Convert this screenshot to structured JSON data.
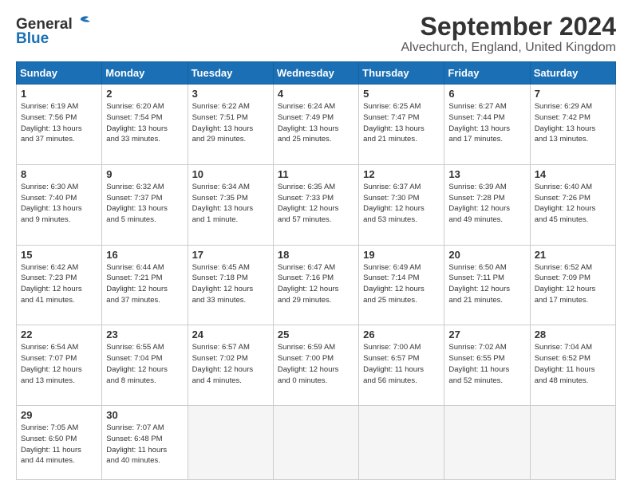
{
  "header": {
    "logo_line1": "General",
    "logo_line2": "Blue",
    "month": "September 2024",
    "location": "Alvechurch, England, United Kingdom"
  },
  "days_of_week": [
    "Sunday",
    "Monday",
    "Tuesday",
    "Wednesday",
    "Thursday",
    "Friday",
    "Saturday"
  ],
  "weeks": [
    [
      {
        "day": "1",
        "info": "Sunrise: 6:19 AM\nSunset: 7:56 PM\nDaylight: 13 hours\nand 37 minutes."
      },
      {
        "day": "2",
        "info": "Sunrise: 6:20 AM\nSunset: 7:54 PM\nDaylight: 13 hours\nand 33 minutes."
      },
      {
        "day": "3",
        "info": "Sunrise: 6:22 AM\nSunset: 7:51 PM\nDaylight: 13 hours\nand 29 minutes."
      },
      {
        "day": "4",
        "info": "Sunrise: 6:24 AM\nSunset: 7:49 PM\nDaylight: 13 hours\nand 25 minutes."
      },
      {
        "day": "5",
        "info": "Sunrise: 6:25 AM\nSunset: 7:47 PM\nDaylight: 13 hours\nand 21 minutes."
      },
      {
        "day": "6",
        "info": "Sunrise: 6:27 AM\nSunset: 7:44 PM\nDaylight: 13 hours\nand 17 minutes."
      },
      {
        "day": "7",
        "info": "Sunrise: 6:29 AM\nSunset: 7:42 PM\nDaylight: 13 hours\nand 13 minutes."
      }
    ],
    [
      {
        "day": "8",
        "info": "Sunrise: 6:30 AM\nSunset: 7:40 PM\nDaylight: 13 hours\nand 9 minutes."
      },
      {
        "day": "9",
        "info": "Sunrise: 6:32 AM\nSunset: 7:37 PM\nDaylight: 13 hours\nand 5 minutes."
      },
      {
        "day": "10",
        "info": "Sunrise: 6:34 AM\nSunset: 7:35 PM\nDaylight: 13 hours\nand 1 minute."
      },
      {
        "day": "11",
        "info": "Sunrise: 6:35 AM\nSunset: 7:33 PM\nDaylight: 12 hours\nand 57 minutes."
      },
      {
        "day": "12",
        "info": "Sunrise: 6:37 AM\nSunset: 7:30 PM\nDaylight: 12 hours\nand 53 minutes."
      },
      {
        "day": "13",
        "info": "Sunrise: 6:39 AM\nSunset: 7:28 PM\nDaylight: 12 hours\nand 49 minutes."
      },
      {
        "day": "14",
        "info": "Sunrise: 6:40 AM\nSunset: 7:26 PM\nDaylight: 12 hours\nand 45 minutes."
      }
    ],
    [
      {
        "day": "15",
        "info": "Sunrise: 6:42 AM\nSunset: 7:23 PM\nDaylight: 12 hours\nand 41 minutes."
      },
      {
        "day": "16",
        "info": "Sunrise: 6:44 AM\nSunset: 7:21 PM\nDaylight: 12 hours\nand 37 minutes."
      },
      {
        "day": "17",
        "info": "Sunrise: 6:45 AM\nSunset: 7:18 PM\nDaylight: 12 hours\nand 33 minutes."
      },
      {
        "day": "18",
        "info": "Sunrise: 6:47 AM\nSunset: 7:16 PM\nDaylight: 12 hours\nand 29 minutes."
      },
      {
        "day": "19",
        "info": "Sunrise: 6:49 AM\nSunset: 7:14 PM\nDaylight: 12 hours\nand 25 minutes."
      },
      {
        "day": "20",
        "info": "Sunrise: 6:50 AM\nSunset: 7:11 PM\nDaylight: 12 hours\nand 21 minutes."
      },
      {
        "day": "21",
        "info": "Sunrise: 6:52 AM\nSunset: 7:09 PM\nDaylight: 12 hours\nand 17 minutes."
      }
    ],
    [
      {
        "day": "22",
        "info": "Sunrise: 6:54 AM\nSunset: 7:07 PM\nDaylight: 12 hours\nand 13 minutes."
      },
      {
        "day": "23",
        "info": "Sunrise: 6:55 AM\nSunset: 7:04 PM\nDaylight: 12 hours\nand 8 minutes."
      },
      {
        "day": "24",
        "info": "Sunrise: 6:57 AM\nSunset: 7:02 PM\nDaylight: 12 hours\nand 4 minutes."
      },
      {
        "day": "25",
        "info": "Sunrise: 6:59 AM\nSunset: 7:00 PM\nDaylight: 12 hours\nand 0 minutes."
      },
      {
        "day": "26",
        "info": "Sunrise: 7:00 AM\nSunset: 6:57 PM\nDaylight: 11 hours\nand 56 minutes."
      },
      {
        "day": "27",
        "info": "Sunrise: 7:02 AM\nSunset: 6:55 PM\nDaylight: 11 hours\nand 52 minutes."
      },
      {
        "day": "28",
        "info": "Sunrise: 7:04 AM\nSunset: 6:52 PM\nDaylight: 11 hours\nand 48 minutes."
      }
    ],
    [
      {
        "day": "29",
        "info": "Sunrise: 7:05 AM\nSunset: 6:50 PM\nDaylight: 11 hours\nand 44 minutes."
      },
      {
        "day": "30",
        "info": "Sunrise: 7:07 AM\nSunset: 6:48 PM\nDaylight: 11 hours\nand 40 minutes."
      },
      {
        "day": "",
        "info": ""
      },
      {
        "day": "",
        "info": ""
      },
      {
        "day": "",
        "info": ""
      },
      {
        "day": "",
        "info": ""
      },
      {
        "day": "",
        "info": ""
      }
    ]
  ]
}
